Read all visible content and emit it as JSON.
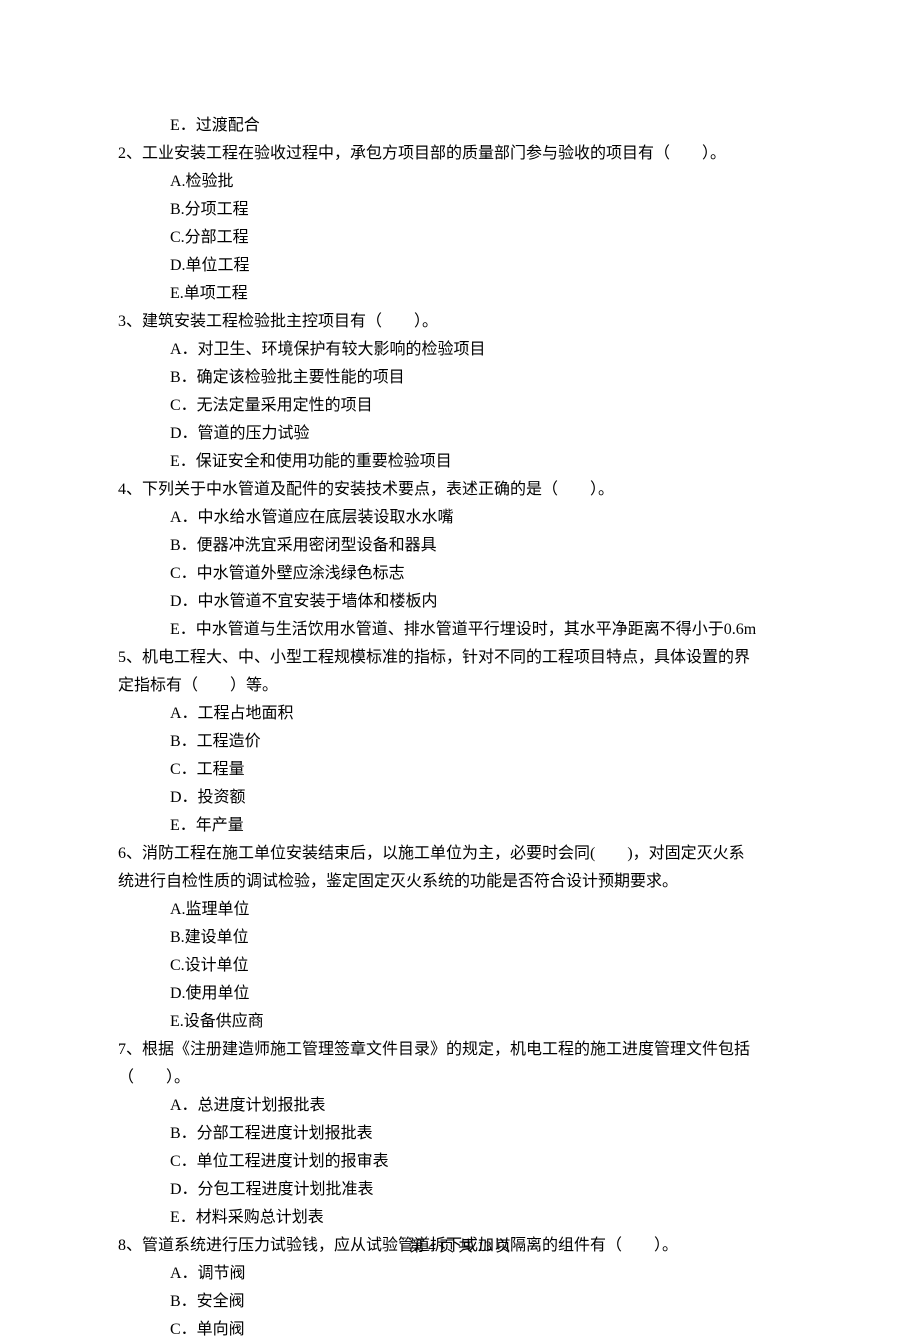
{
  "q1_opt_e": "E．过渡配合",
  "q2": {
    "stem": "2、工业安装工程在验收过程中，承包方项目部的质量部门参与验收的项目有（　　）。",
    "a": "A.检验批",
    "b": "B.分项工程",
    "c": "C.分部工程",
    "d": "D.单位工程",
    "e": "E.单项工程"
  },
  "q3": {
    "stem": "3、建筑安装工程检验批主控项目有（　　）。",
    "a": "A．对卫生、环境保护有较大影响的检验项目",
    "b": "B．确定该检验批主要性能的项目",
    "c": "C．无法定量采用定性的项目",
    "d": "D．管道的压力试验",
    "e": "E．保证安全和使用功能的重要检验项目"
  },
  "q4": {
    "stem": "4、下列关于中水管道及配件的安装技术要点，表述正确的是（　　）。",
    "a": "A．中水给水管道应在底层装设取水水嘴",
    "b": "B．便器冲洗宜采用密闭型设备和器具",
    "c": "C．中水管道外壁应涂浅绿色标志",
    "d": "D．中水管道不宜安装于墙体和楼板内",
    "e": "E．中水管道与生活饮用水管道、排水管道平行埋设时，其水平净距离不得小于0.6m"
  },
  "q5": {
    "stem1": "5、机电工程大、中、小型工程规模标准的指标，针对不同的工程项目特点，具体设置的界",
    "stem2": "定指标有（　　）等。",
    "a": "A．工程占地面积",
    "b": "B．工程造价",
    "c": "C．工程量",
    "d": "D．投资额",
    "e": "E．年产量"
  },
  "q6": {
    "stem1": "6、消防工程在施工单位安装结束后，以施工单位为主，必要时会同(　　)，对固定灭火系",
    "stem2": "统进行自检性质的调试检验，鉴定固定灭火系统的功能是否符合设计预期要求。",
    "a": "A.监理单位",
    "b": "B.建设单位",
    "c": "C.设计单位",
    "d": "D.使用单位",
    "e": "E.设备供应商"
  },
  "q7": {
    "stem1": "7、根据《注册建造师施工管理签章文件目录》的规定，机电工程的施工进度管理文件包括",
    "stem2": "（　　）。",
    "a": "A．总进度计划报批表",
    "b": "B．分部工程进度计划报批表",
    "c": "C．单位工程进度计划的报审表",
    "d": "D．分包工程进度计划批准表",
    "e": "E．材料采购总计划表"
  },
  "q8": {
    "stem": "8、管道系统进行压力试验钱，应从试验管道拆下或加以隔离的组件有（　　）。",
    "a": "A．调节阀",
    "b": "B．安全阀",
    "c": "C．单向阀"
  },
  "footer": "第 4 页 共 13 页"
}
